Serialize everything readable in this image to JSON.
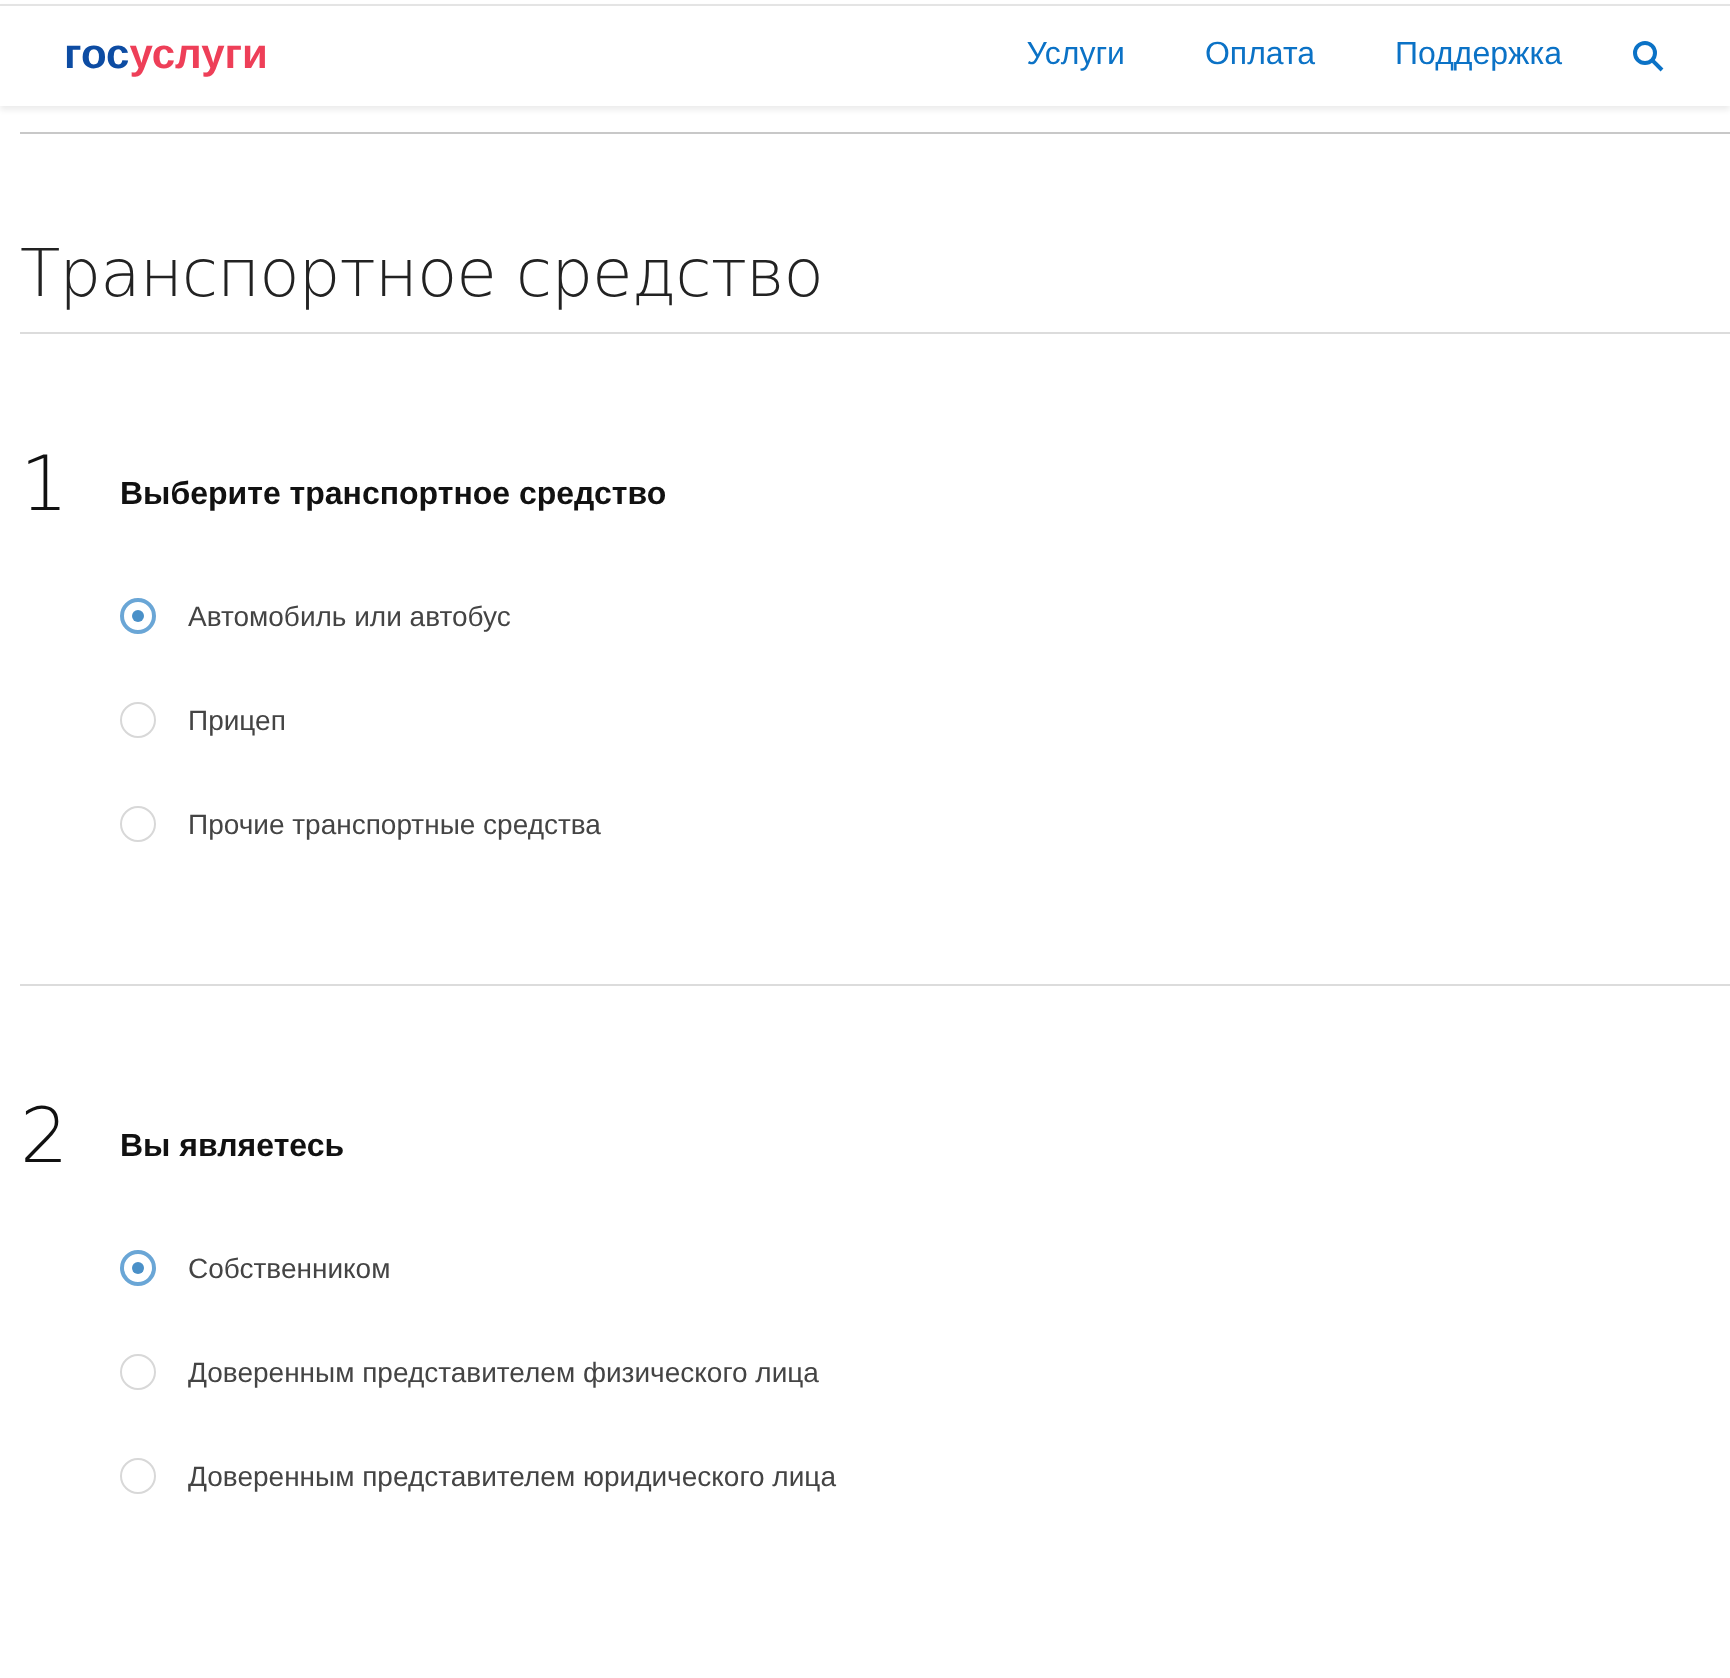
{
  "header": {
    "logo": [
      {
        "text": "гос",
        "color": "#0d4ca3"
      },
      {
        "text": "услуги",
        "color": "#ee3f58"
      }
    ],
    "nav": [
      "Услуги",
      "Оплата",
      "Поддержка"
    ]
  },
  "title": "Транспортное средство",
  "sections": [
    {
      "number": "1",
      "heading": "Выберите транспортное средство",
      "options": [
        {
          "label": "Автомобиль или автобус",
          "selected": true
        },
        {
          "label": "Прицеп",
          "selected": false
        },
        {
          "label": "Прочие транспортные средства",
          "selected": false
        }
      ]
    },
    {
      "number": "2",
      "heading": "Вы являетесь",
      "options": [
        {
          "label": "Собственником",
          "selected": true
        },
        {
          "label": "Доверенным представителем физического лица",
          "selected": false
        },
        {
          "label": "Доверенным представителем юридического лица",
          "selected": false
        }
      ]
    }
  ]
}
